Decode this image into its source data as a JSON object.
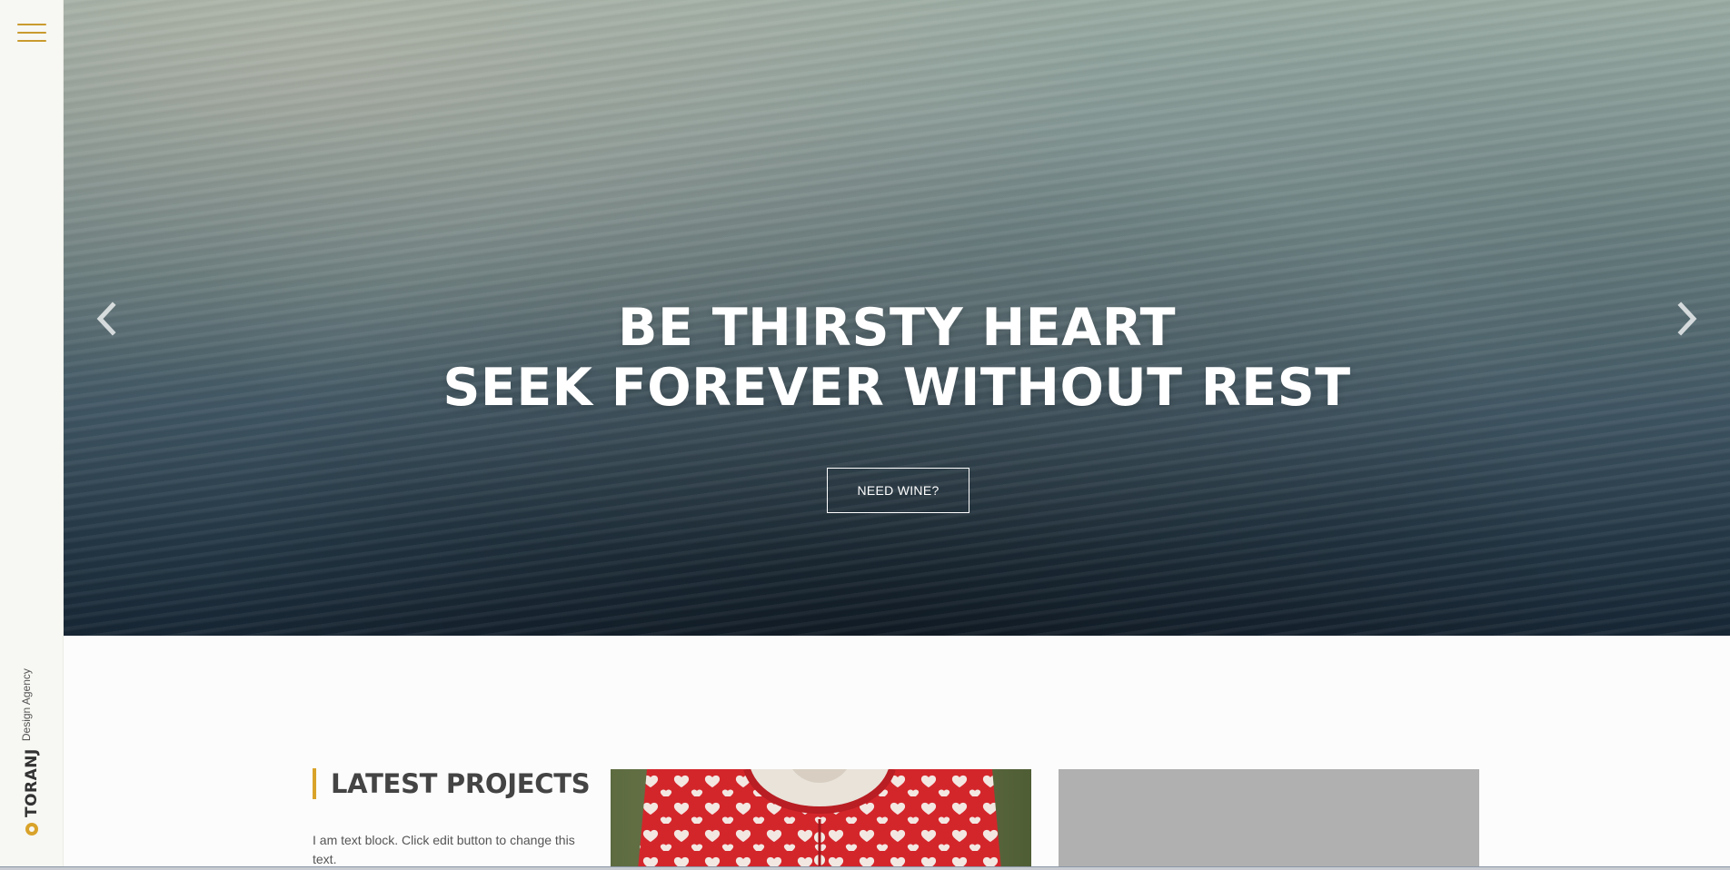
{
  "sidebar": {
    "brand_name": "TORANJ",
    "brand_tagline": "Design Agency"
  },
  "hero": {
    "title_line1": "BE THIRSTY HEART",
    "title_line2": "SEEK FOREVER WITHOUT REST",
    "cta_label": "NEED WINE?"
  },
  "projects": {
    "heading": "LATEST PROJECTS",
    "text": "I am text block. Click edit button to change this text."
  },
  "colors": {
    "accent": "#d9a32a",
    "menu": "#c99b2e"
  }
}
